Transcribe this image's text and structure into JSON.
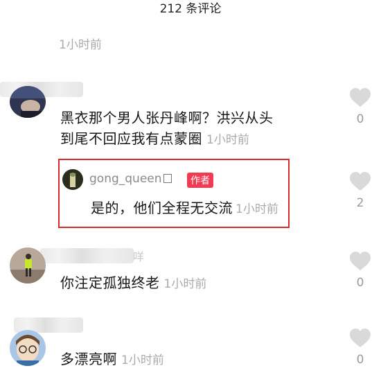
{
  "header": {
    "title": "212 条评论"
  },
  "top_time": "1小时前",
  "comments": [
    {
      "text_line1": "黑衣那个男人张丹峰啊？洪兴从头",
      "text_line2": "到尾不回应我有点蒙圈",
      "time": "1小时前",
      "likes": "0"
    },
    {
      "text": "你注定孤独终老",
      "time": "1小时前",
      "likes": "0",
      "name_suffix": "咩"
    },
    {
      "text": "多漂亮啊",
      "time": "1小时前",
      "likes": "0"
    }
  ],
  "reply": {
    "username": "gong_queen",
    "badge": "作者",
    "text": "是的，他们全程无交流",
    "time": "1小时前",
    "likes": "2"
  },
  "colors": {
    "highlight_border": "#d62b2b",
    "author_badge": "#f23a52",
    "heart": "#d9d9d9",
    "muted_text": "#aaaaaa"
  },
  "icons": {
    "like": "heart-icon"
  }
}
